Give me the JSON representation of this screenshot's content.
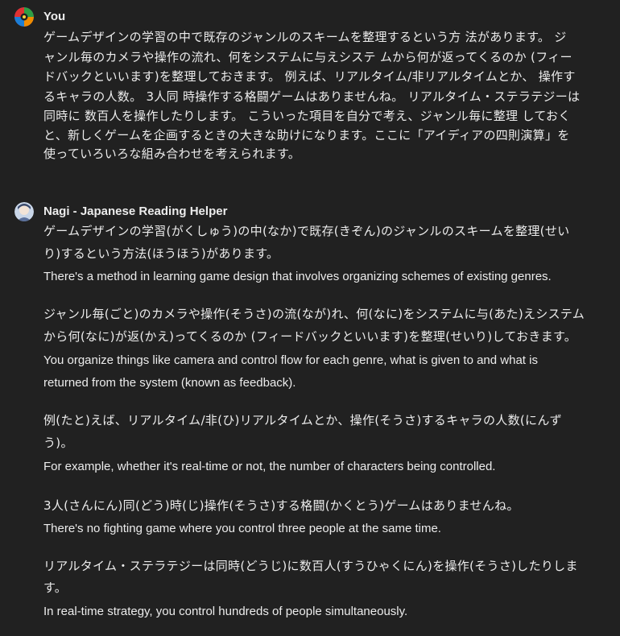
{
  "user_message": {
    "author": "You",
    "lines": [
      "ゲームデザインの学習の中で既存のジャンルのスキームを整理するという方 法があります。 ジ",
      "ャンル毎のカメラや操作の流れ、何をシステムに与えシステ ムから何が返ってくるのか (フィー",
      "ドバックといいます)を整理しておきます。 例えば、リアルタイム/非リアルタイムとか、 操作す",
      "るキャラの人数。 3人同 時操作する格闘ゲームはありませんね。 リアルタイム・ステラテジーは",
      "同時に 数百人を操作したりします。 こういった項目を自分で考え、ジャンル毎に整理 しておく",
      "と、新しくゲームを企画するときの大きな助けになります。ここに「アイディアの四則演算」を",
      "使っていろいろな組み合わせを考えられます。"
    ]
  },
  "assistant_message": {
    "author": "Nagi - Japanese Reading Helper",
    "paragraphs": [
      {
        "jp": [
          "ゲームデザインの学習(がくしゅう)の中(なか)で既存(きぞん)のジャンルのスキームを整理(せい",
          "り)するという方法(ほうほう)があります。"
        ],
        "en": [
          "There's a method in learning game design that involves organizing schemes of existing genres."
        ]
      },
      {
        "jp": [
          "ジャンル毎(ごと)のカメラや操作(そうさ)の流(なが)れ、何(なに)をシステムに与(あた)えシステム",
          "から何(なに)が返(かえ)ってくるのか (フィードバックといいます)を整理(せいり)しておきます。"
        ],
        "en": [
          "You organize things like camera and control flow for each genre, what is given to and what is",
          "returned from the system (known as feedback)."
        ]
      },
      {
        "jp": [
          "例(たと)えば、リアルタイム/非(ひ)リアルタイムとか、操作(そうさ)するキャラの人数(にんず",
          "う)。"
        ],
        "en": [
          "For example, whether it's real-time or not, the number of characters being controlled."
        ]
      },
      {
        "jp": [
          "3人(さんにん)同(どう)時(じ)操作(そうさ)する格闘(かくとう)ゲームはありませんね。"
        ],
        "en": [
          "There's no fighting game where you control three people at the same time."
        ]
      },
      {
        "jp": [
          "リアルタイム・ステラテジーは同時(どうじ)に数百人(すうひゃくにん)を操作(そうさ)したりしま",
          "す。"
        ],
        "en": [
          "In real-time strategy, you control hundreds of people simultaneously."
        ]
      }
    ]
  },
  "colors": {
    "background": "#212121",
    "text": "#ececec"
  }
}
